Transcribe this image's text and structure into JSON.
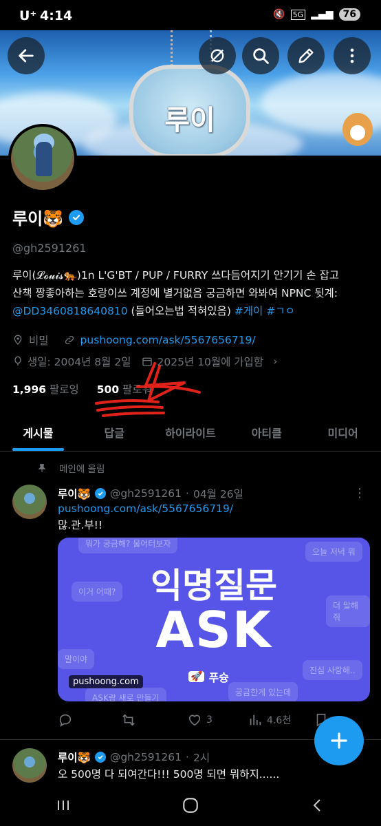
{
  "status_bar": {
    "carrier": "U⁺",
    "time": "4:14",
    "network": "5G",
    "battery": "76"
  },
  "banner": {
    "tag_text": "루이"
  },
  "header_buttons": [
    "back-arrow-icon",
    "grok-icon",
    "search-icon",
    "edit-icon",
    "more-icon"
  ],
  "profile": {
    "name": "루이🐯",
    "handle": "@gh2591261",
    "bio_line1": "루이(𝓛𝓸𝓾𝓲𝓼🐅)1n L'G'BT / PUP / FURRY 쓰다듬어지기 안기기 손 잡고",
    "bio_line2": "산책 짱좋아하는 호랑이쓰 계정에 별거없음 궁금하면 와봐여 NPNC 뒷계:",
    "bio_mention": "@DD3460818640810",
    "bio_suffix": " (들어오는법 적혀있음) ",
    "bio_hashtags": "#게이 #ㄱㅇ",
    "location": "비밀",
    "website": "pushoong.com/ask/5567656719/",
    "birthday": "생일: 2004년 8월 2일",
    "joined": "2025년 10월에 가입함",
    "following_count": "1,996",
    "following_label": "팔로잉",
    "followers_count": "500",
    "followers_label": "팔로워"
  },
  "tabs": [
    "게시물",
    "답글",
    "하이라이트",
    "아티클",
    "미디어"
  ],
  "pinned_label": "메인에 올림",
  "posts": [
    {
      "name": "루이🐯",
      "handle": "@gh2591261",
      "time": "04월 26일",
      "link": "pushoong.com/ask/5567656719/",
      "text": "많.관.부!!",
      "card": {
        "title": "익명질문",
        "subtitle": "ASK",
        "brand": "푸슝",
        "domain": "pushoong.com",
        "bubbles": [
          "뭐가 궁금해? 물어터보자",
          "오늘 저녁 뭐",
          "이거 어때?",
          "더 말해줘",
          "말이야",
          "진심 사랑해..",
          "ASK랑 새로 만들기",
          "궁금한게 있는데"
        ]
      },
      "likes": "3",
      "views": "4.6천"
    },
    {
      "name": "루이🐯",
      "handle": "@gh2591261",
      "time": "2시",
      "text": "오 500명 다 되여간다!!! 500명 되면 뭐하지......"
    }
  ]
}
